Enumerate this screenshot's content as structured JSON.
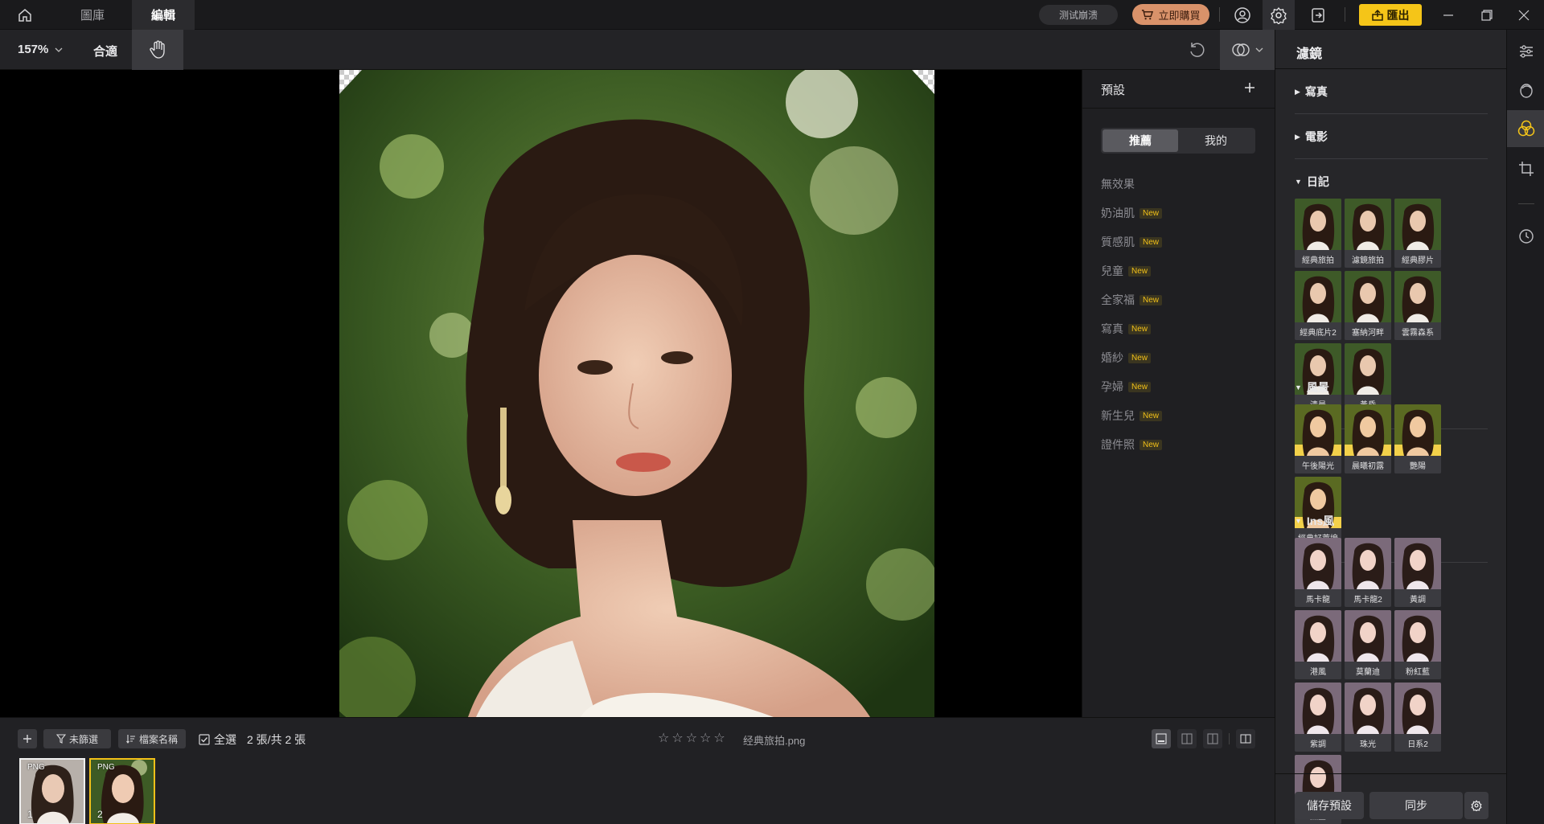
{
  "titlebar": {
    "tabs": [
      "圖庫",
      "編輯"
    ],
    "active_tab": "編輯",
    "test_label": "测试崩溃",
    "buy_label": "立即購買",
    "export_label": "匯出"
  },
  "toolbar": {
    "zoom": "157%",
    "fit_label": "合適"
  },
  "presets": {
    "title": "預設",
    "segments": [
      "推薦",
      "我的"
    ],
    "active_segment": "推薦",
    "new_badge": "New",
    "items": [
      {
        "label": "無效果",
        "new": false
      },
      {
        "label": "奶油肌",
        "new": true
      },
      {
        "label": "質感肌",
        "new": true
      },
      {
        "label": "兒童",
        "new": true
      },
      {
        "label": "全家福",
        "new": true
      },
      {
        "label": "寫真",
        "new": true
      },
      {
        "label": "婚紗",
        "new": true
      },
      {
        "label": "孕婦",
        "new": true
      },
      {
        "label": "新生兒",
        "new": true
      },
      {
        "label": "證件照",
        "new": true
      }
    ]
  },
  "filters": {
    "title": "濾鏡",
    "sections": [
      {
        "title": "寫真",
        "expanded": false,
        "items": []
      },
      {
        "title": "電影",
        "expanded": false,
        "items": []
      },
      {
        "title": "日記",
        "expanded": true,
        "items": [
          "經典旅拍",
          "濾鏡旅拍",
          "經典膠片",
          "經典底片2",
          "塞納河畔",
          "雲霧森系",
          "清晨",
          "黃昏"
        ]
      },
      {
        "title": "風景",
        "expanded": true,
        "items": [
          "午後陽光",
          "晨曦初露",
          "艷陽",
          "經典好萊塢"
        ]
      },
      {
        "title": "Ins風",
        "expanded": true,
        "items": [
          "馬卡龍",
          "馬卡龍2",
          "黃調",
          "港風",
          "莫蘭迪",
          "粉紅藍",
          "紫調",
          "珠光",
          "日系2",
          "黑金"
        ]
      }
    ],
    "save_preset_label": "儲存預設",
    "sync_label": "同步"
  },
  "bottombar": {
    "unfiltered_label": "未篩選",
    "sort_label": "檔案名稱",
    "select_all_label": "全選",
    "count_label": "2 張/共 2 張",
    "rating": 0,
    "filename": "经典旅拍.png",
    "filmstrip": [
      {
        "tag": "PNG",
        "num": "1"
      },
      {
        "tag": "PNG",
        "num": "2"
      }
    ]
  },
  "colors": {
    "accent": "#f5c518",
    "buy": "#d9926a",
    "bg": "#1e1e20"
  }
}
